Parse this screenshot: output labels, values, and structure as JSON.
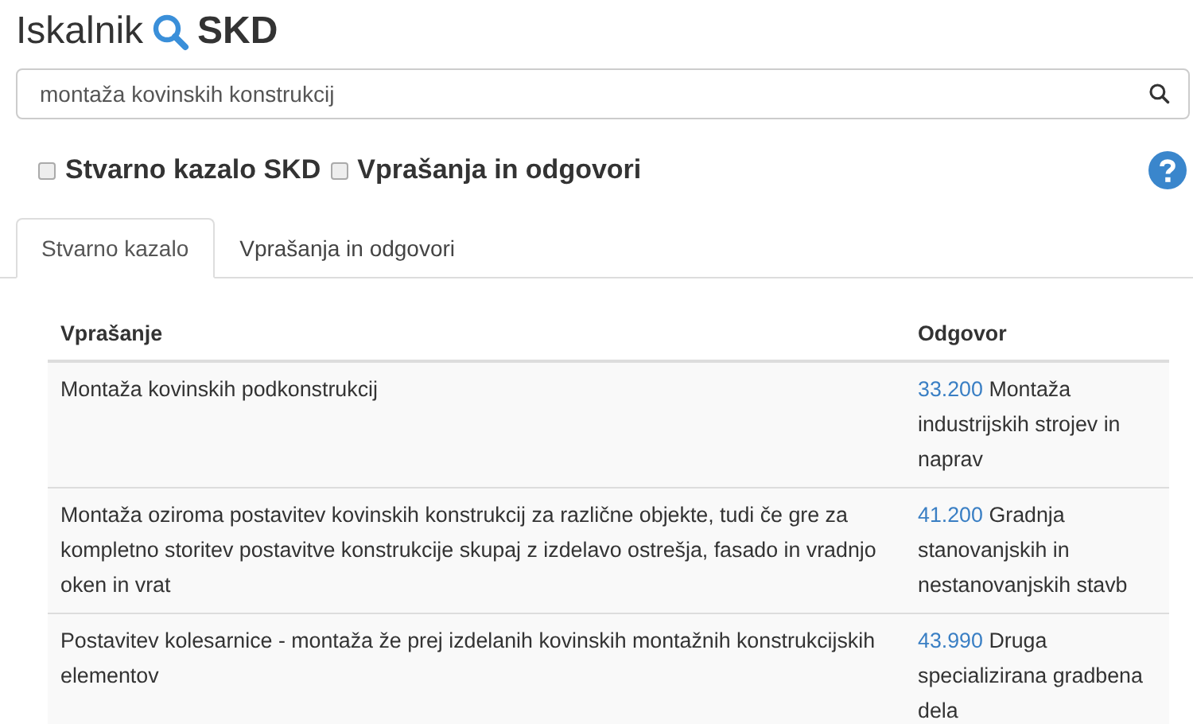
{
  "header": {
    "title_left": "Iskalnik",
    "title_right": "SKD"
  },
  "search": {
    "value": "montaža kovinskih konstrukcij"
  },
  "filters": [
    {
      "label": "Stvarno kazalo SKD",
      "checked": false
    },
    {
      "label": "Vprašanja in odgovori",
      "checked": false
    }
  ],
  "tabs": [
    {
      "label": "Stvarno kazalo",
      "selected": true
    },
    {
      "label": "Vprašanja in odgovori",
      "selected": false
    }
  ],
  "table": {
    "columns": [
      "Vprašanje",
      "Odgovor"
    ],
    "rows": [
      {
        "question": "Montaža kovinskih podkonstrukcij",
        "code": "33.200",
        "answer": "Montaža industrijskih strojev in naprav"
      },
      {
        "question": "Montaža oziroma postavitev kovinskih konstrukcij za različne objekte, tudi če gre za kompletno storitev postavitve konstrukcije skupaj z izdelavo ostrešja, fasado in vradnjo oken in vrat",
        "code": "41.200",
        "answer": "Gradnja stanovanjskih in nestanovanjskih stavb"
      },
      {
        "question": "Postavitev kolesarnice - montaža že prej izdelanih kovinskih montažnih konstrukcijskih elementov",
        "code": "43.990",
        "answer": "Druga specializirana gradbena dela"
      }
    ]
  }
}
